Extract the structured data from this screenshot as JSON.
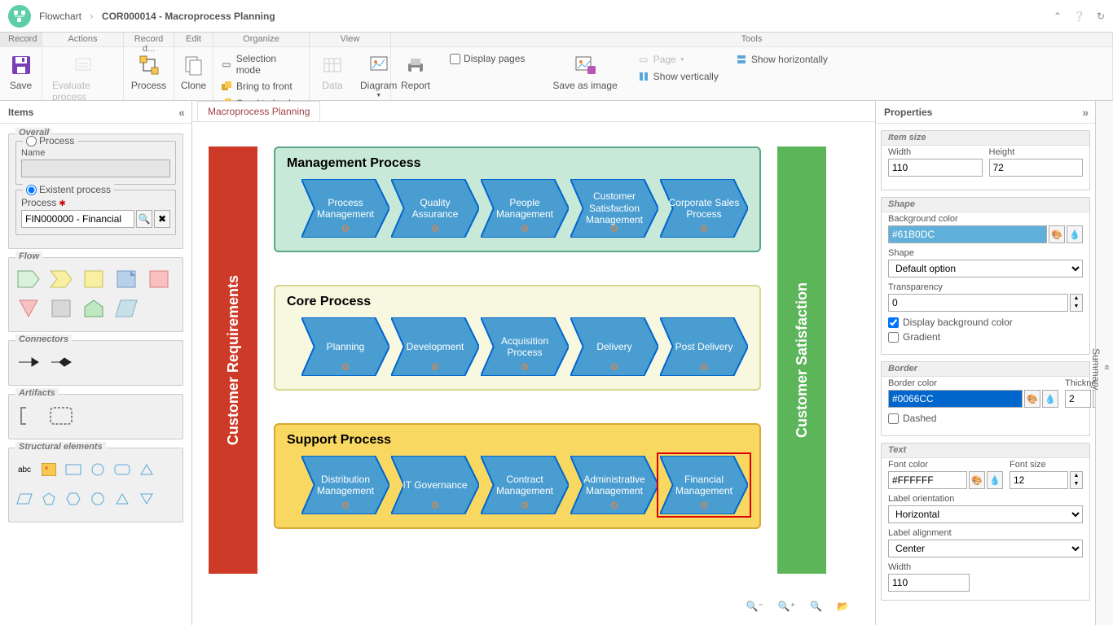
{
  "breadcrumb": {
    "root": "Flowchart",
    "title": "COR000014 - Macroprocess Planning"
  },
  "ribbonTabs": [
    "Record",
    "Actions",
    "Record d...",
    "Edit",
    "Organize",
    "View",
    "Tools"
  ],
  "ribbon": {
    "save": "Save",
    "evaluate": "Evaluate process",
    "process": "Process",
    "clone": "Clone",
    "selection": "Selection mode",
    "bringFront": "Bring to front",
    "sendBack": "Send to back",
    "data": "Data",
    "diagram": "Diagram",
    "report": "Report",
    "displayPages": "Display pages",
    "saveAsImage": "Save as image",
    "page": "Page",
    "showVertically": "Show vertically",
    "showHorizontally": "Show horizontally"
  },
  "leftPanel": {
    "header": "Items",
    "overall": "Overall",
    "processRadio": "Process",
    "nameLabel": "Name",
    "existentRadio": "Existent process",
    "processLabel": "Process",
    "processValue": "FIN000000 - Financial",
    "flow": "Flow",
    "connectors": "Connectors",
    "artifacts": "Artifacts",
    "structural": "Structural elements"
  },
  "canvas": {
    "tab": "Macroprocess Planning",
    "leftBar": "Customer Requirements",
    "rightBar": "Customer Satisfaction",
    "groups": [
      {
        "title": "Management Process",
        "items": [
          "Process Management",
          "Quality Assurance",
          "People Management",
          "Customer Satisfaction Management",
          "Corporate Sales Process"
        ]
      },
      {
        "title": "Core Process",
        "items": [
          "Planning",
          "Development",
          "Acquisition Process",
          "Delivery",
          "Post Delivery"
        ]
      },
      {
        "title": "Support Process",
        "items": [
          "Distribution Management",
          "IT Governance",
          "Contract Management",
          "Administrative Management",
          "Financial Management"
        ],
        "selected": 4
      }
    ]
  },
  "properties": {
    "header": "Properties",
    "itemSize": {
      "title": "Item size",
      "widthLabel": "Width",
      "width": "110",
      "heightLabel": "Height",
      "height": "72"
    },
    "shape": {
      "title": "Shape",
      "bgLabel": "Background color",
      "bgColor": "#61B0DC",
      "shapeLabel": "Shape",
      "shapeValue": "Default option",
      "transLabel": "Transparency",
      "transValue": "0",
      "displayBg": "Display background color",
      "gradient": "Gradient"
    },
    "border": {
      "title": "Border",
      "colorLabel": "Border color",
      "color": "#0066CC",
      "thickLabel": "Thickness",
      "thick": "2",
      "dashed": "Dashed"
    },
    "text": {
      "title": "Text",
      "colorLabel": "Font color",
      "color": "#FFFFFF",
      "sizeLabel": "Font size",
      "size": "12",
      "orientLabel": "Label orientation",
      "orient": "Horizontal",
      "alignLabel": "Label alignment",
      "align": "Center",
      "widthLabel": "Width",
      "width": "110"
    }
  },
  "summary": "Summary"
}
